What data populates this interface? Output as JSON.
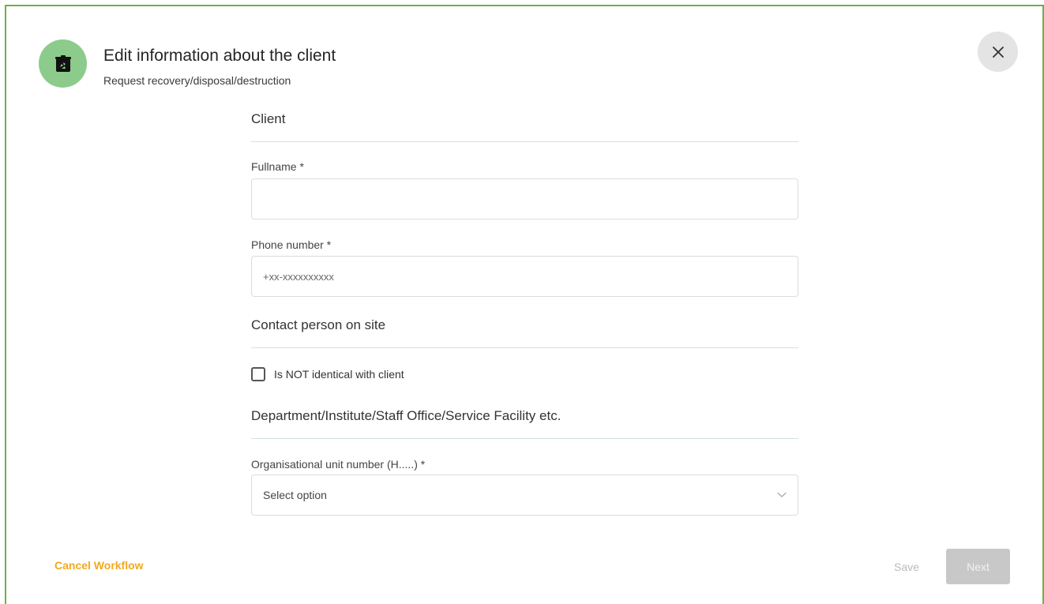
{
  "header": {
    "title": "Edit information about the client",
    "subtitle": "Request recovery/disposal/destruction",
    "icon": "recycle-bin-icon"
  },
  "close_icon": "close-icon",
  "sections": {
    "client": {
      "title": "Client",
      "fullname": {
        "label": "Fullname *",
        "value": "",
        "placeholder": ""
      },
      "phone": {
        "label": "Phone number *",
        "value": "",
        "placeholder": "+xx-xxxxxxxxxx"
      }
    },
    "contact": {
      "title": "Contact person on site",
      "checkbox": {
        "label": "Is NOT identical with client",
        "checked": false
      }
    },
    "department": {
      "title": "Department/Institute/Staff Office/Service Facility etc.",
      "org_unit": {
        "label": "Organisational unit number (H.....) *",
        "selected": "Select option"
      }
    }
  },
  "footer": {
    "cancel_label": "Cancel Workflow",
    "save_label": "Save",
    "next_label": "Next"
  },
  "colors": {
    "accent_green": "#6fb047",
    "icon_circle": "#8ccb8c",
    "cancel_orange": "#f2a91f",
    "disabled_gray": "#c8c8c8"
  }
}
